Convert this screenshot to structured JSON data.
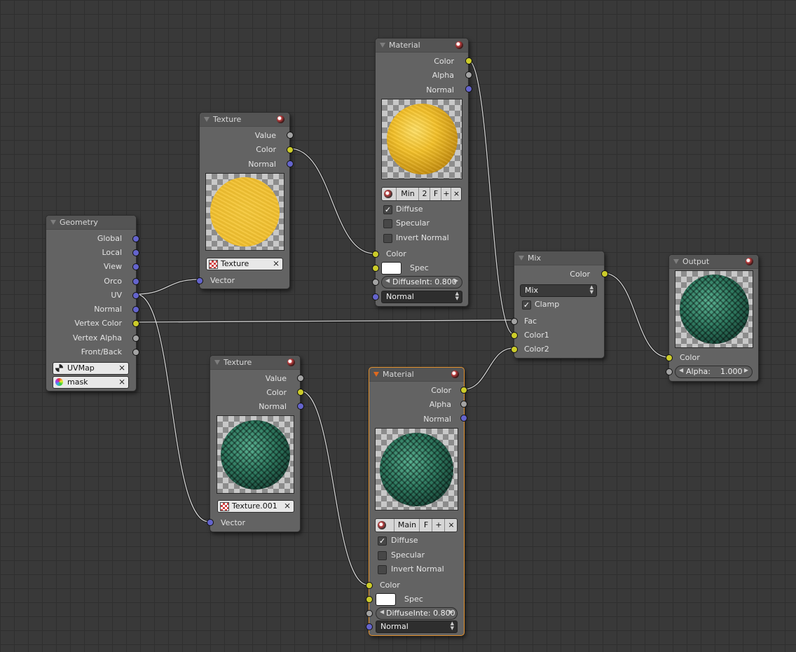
{
  "colors": {
    "grid_bg": "#393939",
    "node_bg": "#636363",
    "active_outline": "#e2902c",
    "socket_color": "#cccc2a",
    "socket_vector": "#6464cc",
    "socket_value": "#a3a3a3"
  },
  "geometry": {
    "title": "Geometry",
    "outputs": [
      "Global",
      "Local",
      "View",
      "Orco",
      "UV",
      "Normal",
      "Vertex Color",
      "Vertex Alpha",
      "Front/Back"
    ],
    "uv_map": "UVMap",
    "vertex_color": "mask"
  },
  "texture1": {
    "title": "Texture",
    "outputs": [
      "Value",
      "Color",
      "Normal"
    ],
    "texture": "Texture",
    "input": "Vector"
  },
  "texture2": {
    "title": "Texture",
    "outputs": [
      "Value",
      "Color",
      "Normal"
    ],
    "texture": "Texture.001",
    "input": "Vector"
  },
  "material1": {
    "title": "Material",
    "outputs": [
      "Color",
      "Alpha",
      "Normal"
    ],
    "toolbar": [
      "Min",
      "2",
      "F"
    ],
    "checks": [
      {
        "label": "Diffuse",
        "checked": true
      },
      {
        "label": "Specular",
        "checked": false
      },
      {
        "label": "Invert Normal",
        "checked": false
      }
    ],
    "in_color": "Color",
    "in_spec": "Spec",
    "diffuse": "DiffuseInt: 0.800",
    "normal": "Normal"
  },
  "material2": {
    "title": "Material",
    "outputs": [
      "Color",
      "Alpha",
      "Normal"
    ],
    "toolbar": [
      "Main",
      "F"
    ],
    "checks": [
      {
        "label": "Diffuse",
        "checked": true
      },
      {
        "label": "Specular",
        "checked": false
      },
      {
        "label": "Invert Normal",
        "checked": false
      }
    ],
    "in_color": "Color",
    "in_spec": "Spec",
    "diffuse": "DiffuseInte: 0.800",
    "normal": "Normal"
  },
  "mix": {
    "title": "Mix",
    "output": "Color",
    "mode": "Mix",
    "clamp": "Clamp",
    "inputs": [
      "Fac",
      "Color1",
      "Color2"
    ]
  },
  "output": {
    "title": "Output",
    "input": "Color",
    "alpha_label": "Alpha:",
    "alpha_value": "1.000"
  },
  "icons": {
    "check": "✓",
    "close": "⨯",
    "add": "+",
    "collapse": "triangle-down"
  }
}
